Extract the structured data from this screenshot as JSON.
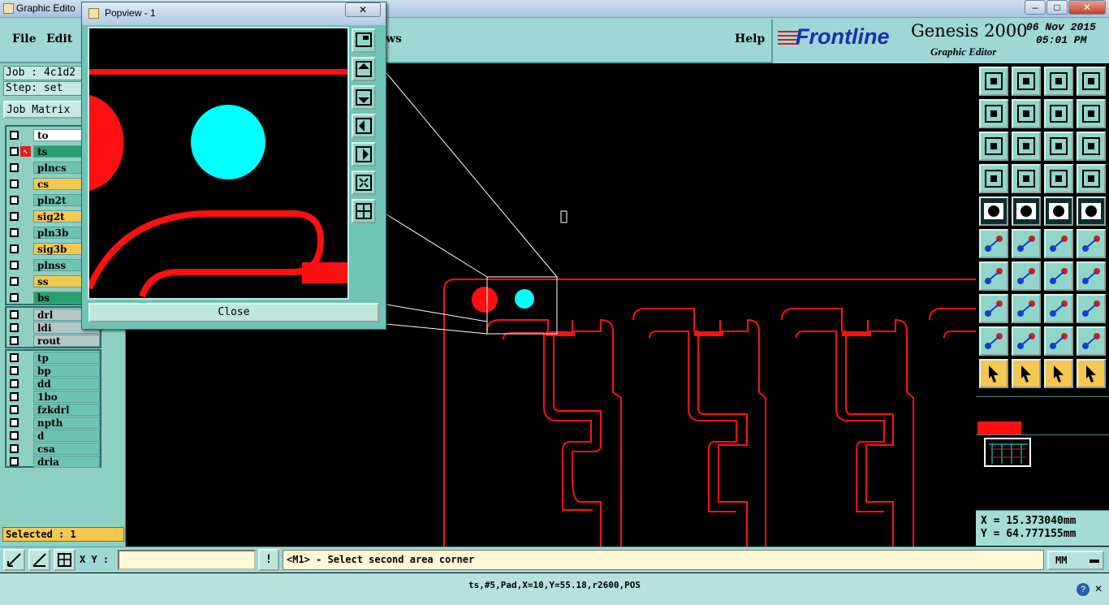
{
  "window": {
    "title": "Graphic Edito",
    "controls": [
      "–",
      "□",
      "✕"
    ]
  },
  "menu": {
    "file": "File",
    "edit": "Edit",
    "views": "ws",
    "help": "Help"
  },
  "brand": {
    "logo": "Frontline",
    "product": "Genesis 2000",
    "subtitle": "Graphic Editor",
    "date": "06 Nov 2015",
    "time": "05:01 PM"
  },
  "left": {
    "job": "Job : 4c1d2",
    "step": "Step: set",
    "job_matrix": "Job Matrix",
    "layers_main": [
      {
        "name": "to",
        "style": "white"
      },
      {
        "name": "ts",
        "style": "green"
      },
      {
        "name": "plncs",
        "style": "teal"
      },
      {
        "name": "cs",
        "style": "yellow"
      },
      {
        "name": "pln2t",
        "style": "teal"
      },
      {
        "name": "sig2t",
        "style": "yellow"
      },
      {
        "name": "pln3b",
        "style": "teal"
      },
      {
        "name": "sig3b",
        "style": "yellow"
      },
      {
        "name": "plnss",
        "style": "teal"
      },
      {
        "name": "ss",
        "style": "yellow"
      },
      {
        "name": "bs",
        "style": "green"
      }
    ],
    "layers_drill": [
      "drl",
      "ldi",
      "rout"
    ],
    "layers_misc": [
      "tp",
      "bp",
      "dd",
      "1bo",
      "fzkdrl",
      "npth",
      "d",
      "csa",
      "drla"
    ],
    "selected": "Selected : 1"
  },
  "popview": {
    "title": "Popview - 1",
    "close_label": "Close"
  },
  "coords": {
    "x": "X = 15.373040mm",
    "y": "Y = 64.777155mm"
  },
  "status": {
    "xy_label": "X Y :",
    "xy_value": "",
    "message": "<M1> - Select second area corner",
    "units": "MM"
  },
  "footer": {
    "info": "ts,#5,Pad,X=10,Y=55.18,r2600,POS"
  },
  "colors": {
    "feature": "#ff0000",
    "pad_highlight": "#00ffff",
    "panel": "#9fd6d6"
  }
}
